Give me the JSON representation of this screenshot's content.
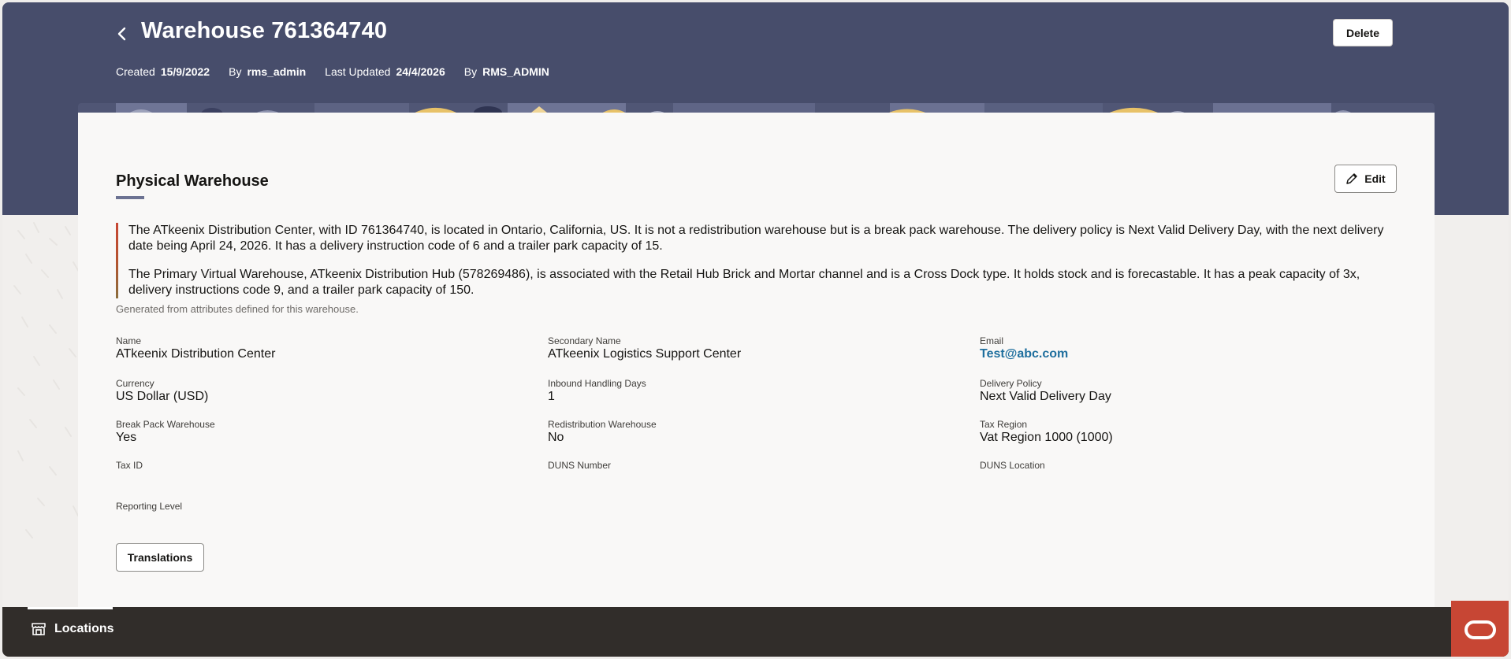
{
  "header": {
    "title": "Warehouse 761364740",
    "delete_label": "Delete",
    "meta": {
      "created_label": "Created",
      "created_value": "15/9/2022",
      "created_by_label": "By",
      "created_by_value": "rms_admin",
      "updated_label": "Last Updated",
      "updated_value": "24/4/2026",
      "updated_by_label": "By",
      "updated_by_value": "RMS_ADMIN"
    }
  },
  "card": {
    "title": "Physical Warehouse",
    "edit_label": "Edit",
    "summary": [
      "The ATkeenix Distribution Center, with ID 761364740, is located in Ontario, California, US. It is not a redistribution warehouse but is a break pack warehouse. The delivery policy is Next Valid Delivery Day, with the next delivery date being April 24, 2026. It has a delivery instruction code of 6 and a trailer park capacity of 15.",
      "The Primary Virtual Warehouse, ATkeenix Distribution Hub (578269486), is associated with the Retail Hub Brick and Mortar channel and is a Cross Dock type. It holds stock and is forecastable. It has a peak capacity of 3x, delivery instructions code 9, and a trailer park capacity of 150."
    ],
    "summary_note": "Generated from attributes defined for this warehouse.",
    "fields": {
      "name": {
        "label": "Name",
        "value": "ATkeenix Distribution Center"
      },
      "secondary_name": {
        "label": "Secondary Name",
        "value": "ATkeenix Logistics Support Center"
      },
      "email": {
        "label": "Email",
        "value": "Test@abc.com"
      },
      "currency": {
        "label": "Currency",
        "value": "US Dollar (USD)"
      },
      "inbound_days": {
        "label": "Inbound Handling Days",
        "value": "1"
      },
      "delivery_policy": {
        "label": "Delivery Policy",
        "value": "Next Valid Delivery Day"
      },
      "break_pack": {
        "label": "Break Pack Warehouse",
        "value": "Yes"
      },
      "redistribution": {
        "label": "Redistribution Warehouse",
        "value": "No"
      },
      "tax_region": {
        "label": "Tax Region",
        "value": "Vat Region 1000 (1000)"
      },
      "tax_id": {
        "label": "Tax ID",
        "value": ""
      },
      "duns_number": {
        "label": "DUNS Number",
        "value": ""
      },
      "duns_location": {
        "label": "DUNS Location",
        "value": ""
      },
      "reporting_level": {
        "label": "Reporting Level",
        "value": ""
      }
    },
    "translations_label": "Translations"
  },
  "footer": {
    "locations_label": "Locations"
  },
  "icons": {
    "back": "chevron-left-icon",
    "edit": "pencil-icon",
    "locations": "store-icon",
    "oracle": "oracle-logo-icon"
  },
  "colors": {
    "header": "#474d6b",
    "footer": "#312d2a",
    "oracle_red": "#c74634",
    "link": "#1f6f9e"
  }
}
